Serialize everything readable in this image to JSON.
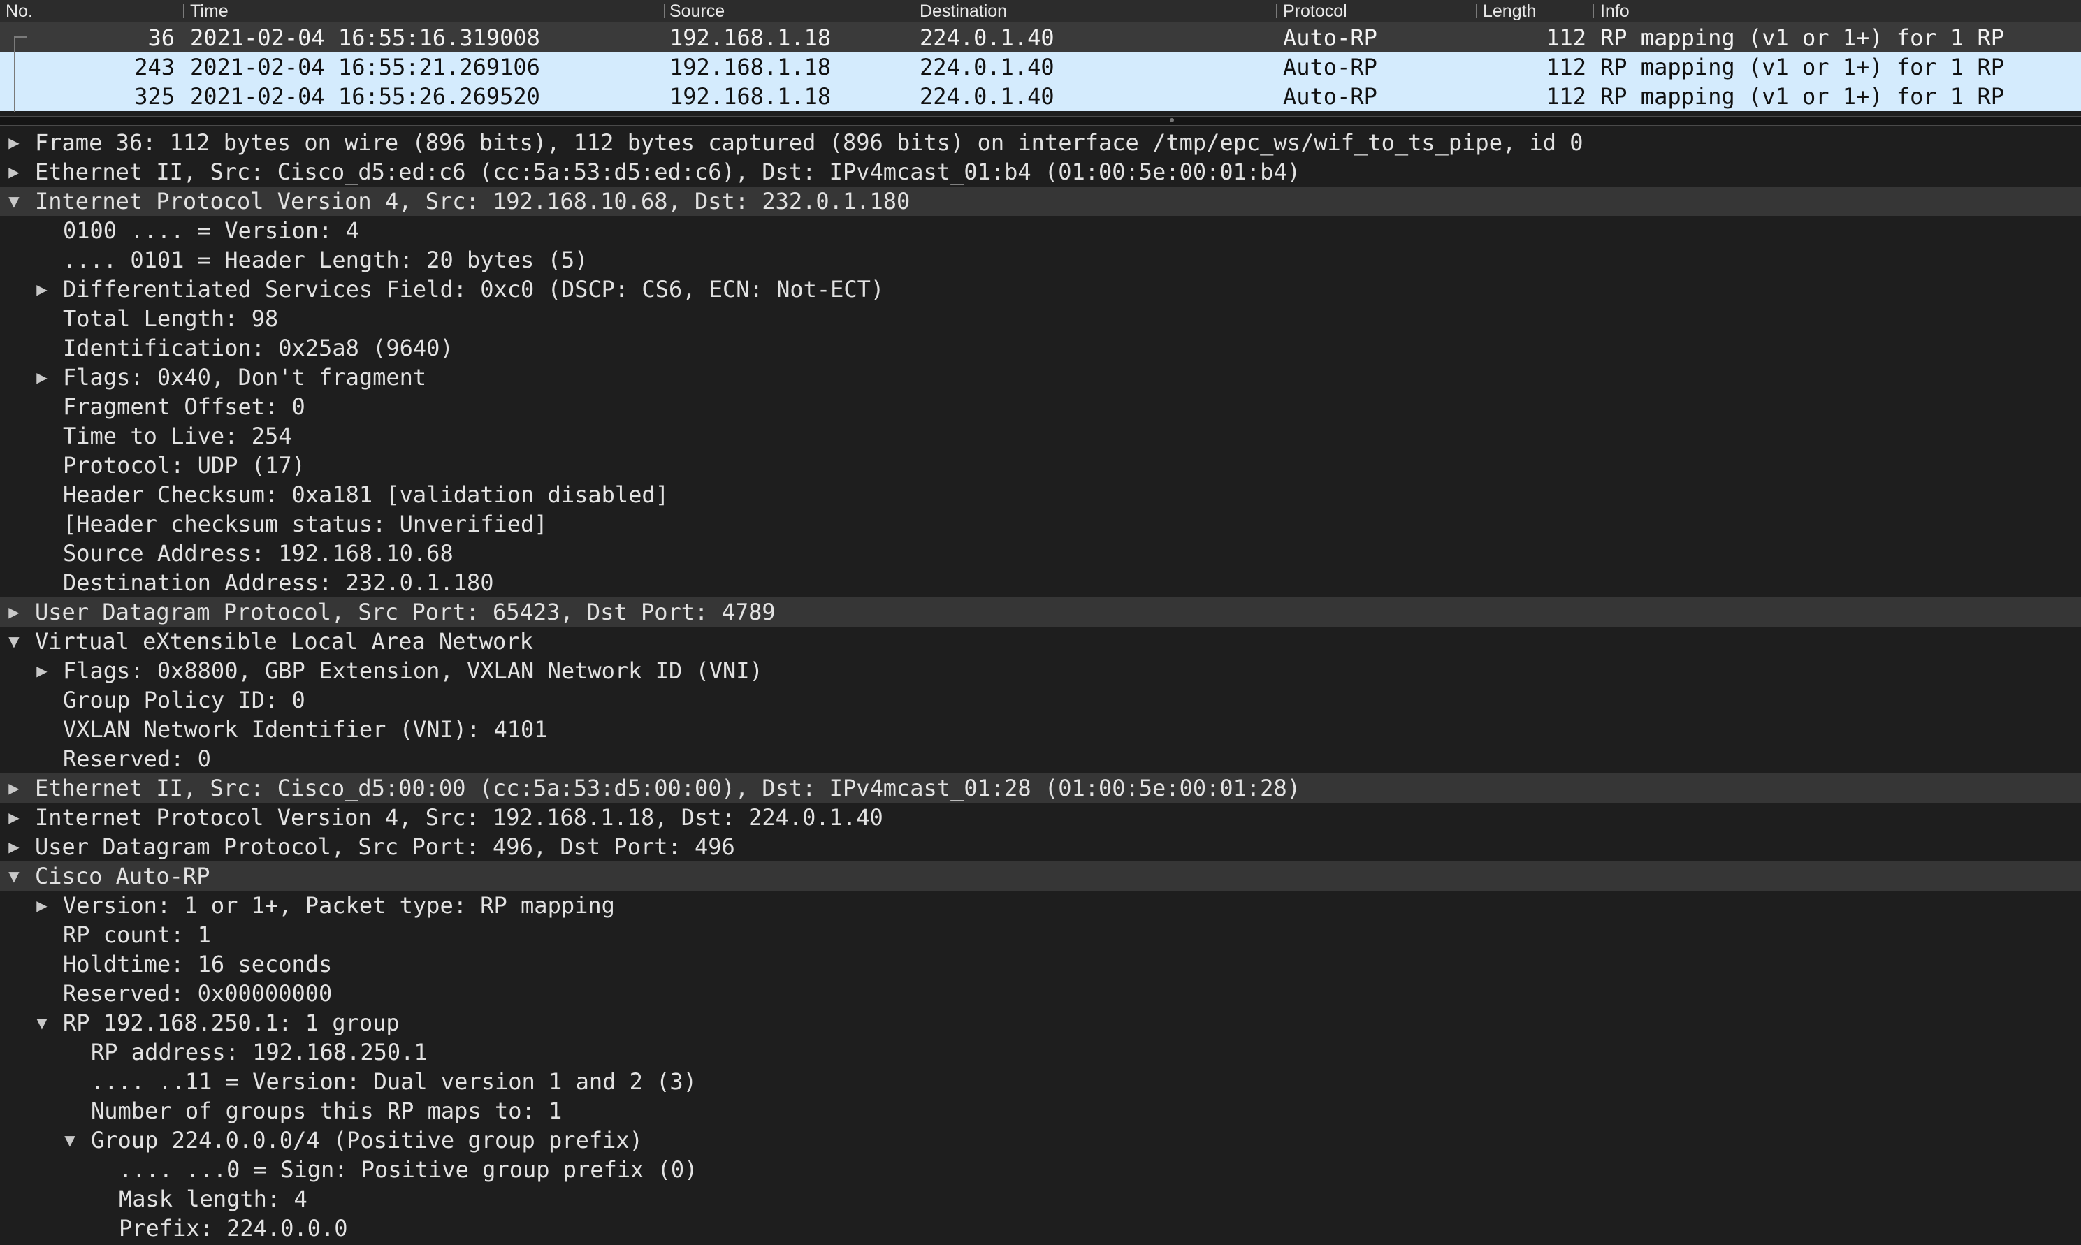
{
  "columns": [
    "No.",
    "Time",
    "Source",
    "Destination",
    "Protocol",
    "Length",
    "Info"
  ],
  "packets": [
    {
      "no": "36",
      "time": "2021-02-04 16:55:16.319008",
      "source": "192.168.1.18",
      "destination": "224.0.1.40",
      "protocol": "Auto-RP",
      "length": "112",
      "info": "RP mapping (v1 or 1+) for 1 RP",
      "state": "selected"
    },
    {
      "no": "243",
      "time": "2021-02-04 16:55:21.269106",
      "source": "192.168.1.18",
      "destination": "224.0.1.40",
      "protocol": "Auto-RP",
      "length": "112",
      "info": "RP mapping (v1 or 1+) for 1 RP",
      "state": "related"
    },
    {
      "no": "325",
      "time": "2021-02-04 16:55:26.269520",
      "source": "192.168.1.18",
      "destination": "224.0.1.40",
      "protocol": "Auto-RP",
      "length": "112",
      "info": "RP mapping (v1 or 1+) for 1 RP",
      "state": "related"
    }
  ],
  "details": [
    {
      "level": 0,
      "expander": "collapsed",
      "text": "Frame 36: 112 bytes on wire (896 bits), 112 bytes captured (896 bits) on interface /tmp/epc_ws/wif_to_ts_pipe, id 0"
    },
    {
      "level": 0,
      "expander": "collapsed",
      "text": "Ethernet II, Src: Cisco_d5:ed:c6 (cc:5a:53:d5:ed:c6), Dst: IPv4mcast_01:b4 (01:00:5e:00:01:b4)"
    },
    {
      "level": 0,
      "expander": "expanded",
      "text": "Internet Protocol Version 4, Src: 192.168.10.68, Dst: 232.0.1.180",
      "highlight": true
    },
    {
      "level": 1,
      "expander": "none",
      "text": "0100 .... = Version: 4"
    },
    {
      "level": 1,
      "expander": "none",
      "text": ".... 0101 = Header Length: 20 bytes (5)"
    },
    {
      "level": 1,
      "expander": "collapsed",
      "text": "Differentiated Services Field: 0xc0 (DSCP: CS6, ECN: Not-ECT)"
    },
    {
      "level": 1,
      "expander": "none",
      "text": "Total Length: 98"
    },
    {
      "level": 1,
      "expander": "none",
      "text": "Identification: 0x25a8 (9640)"
    },
    {
      "level": 1,
      "expander": "collapsed",
      "text": "Flags: 0x40, Don't fragment"
    },
    {
      "level": 1,
      "expander": "none",
      "text": "Fragment Offset: 0"
    },
    {
      "level": 1,
      "expander": "none",
      "text": "Time to Live: 254"
    },
    {
      "level": 1,
      "expander": "none",
      "text": "Protocol: UDP (17)"
    },
    {
      "level": 1,
      "expander": "none",
      "text": "Header Checksum: 0xa181 [validation disabled]"
    },
    {
      "level": 1,
      "expander": "none",
      "text": "[Header checksum status: Unverified]"
    },
    {
      "level": 1,
      "expander": "none",
      "text": "Source Address: 192.168.10.68"
    },
    {
      "level": 1,
      "expander": "none",
      "text": "Destination Address: 232.0.1.180"
    },
    {
      "level": 0,
      "expander": "collapsed",
      "text": "User Datagram Protocol, Src Port: 65423, Dst Port: 4789",
      "highlight": true
    },
    {
      "level": 0,
      "expander": "expanded",
      "text": "Virtual eXtensible Local Area Network"
    },
    {
      "level": 1,
      "expander": "collapsed",
      "text": "Flags: 0x8800, GBP Extension, VXLAN Network ID (VNI)"
    },
    {
      "level": 1,
      "expander": "none",
      "text": "Group Policy ID: 0"
    },
    {
      "level": 1,
      "expander": "none",
      "text": "VXLAN Network Identifier (VNI): 4101"
    },
    {
      "level": 1,
      "expander": "none",
      "text": "Reserved: 0"
    },
    {
      "level": 0,
      "expander": "collapsed",
      "text": "Ethernet II, Src: Cisco_d5:00:00 (cc:5a:53:d5:00:00), Dst: IPv4mcast_01:28 (01:00:5e:00:01:28)",
      "highlight": true
    },
    {
      "level": 0,
      "expander": "collapsed",
      "text": "Internet Protocol Version 4, Src: 192.168.1.18, Dst: 224.0.1.40"
    },
    {
      "level": 0,
      "expander": "collapsed",
      "text": "User Datagram Protocol, Src Port: 496, Dst Port: 496"
    },
    {
      "level": 0,
      "expander": "expanded",
      "text": "Cisco Auto-RP",
      "highlight": true
    },
    {
      "level": 1,
      "expander": "collapsed",
      "text": "Version: 1 or 1+, Packet type: RP mapping"
    },
    {
      "level": 1,
      "expander": "none",
      "text": "RP count: 1"
    },
    {
      "level": 1,
      "expander": "none",
      "text": "Holdtime: 16 seconds"
    },
    {
      "level": 1,
      "expander": "none",
      "text": "Reserved: 0x00000000"
    },
    {
      "level": 1,
      "expander": "expanded",
      "text": "RP 192.168.250.1: 1 group"
    },
    {
      "level": 2,
      "expander": "none",
      "text": "RP address: 192.168.250.1"
    },
    {
      "level": 2,
      "expander": "none",
      "text": ".... ..11 = Version: Dual version 1 and 2 (3)"
    },
    {
      "level": 2,
      "expander": "none",
      "text": "Number of groups this RP maps to: 1"
    },
    {
      "level": 2,
      "expander": "expanded",
      "text": "Group 224.0.0.0/4 (Positive group prefix)"
    },
    {
      "level": 3,
      "expander": "none",
      "text": ".... ...0 = Sign: Positive group prefix (0)"
    },
    {
      "level": 3,
      "expander": "none",
      "text": "Mask length: 4"
    },
    {
      "level": 3,
      "expander": "none",
      "text": "Prefix: 224.0.0.0"
    }
  ],
  "colors": {
    "background": "#1e1e1e",
    "selected_row": "#3a3a3a",
    "related_row": "#d4ebfd",
    "highlight_row": "#363636"
  },
  "icons": {
    "collapsed": "triangle-right-icon",
    "expanded": "triangle-down-icon"
  }
}
